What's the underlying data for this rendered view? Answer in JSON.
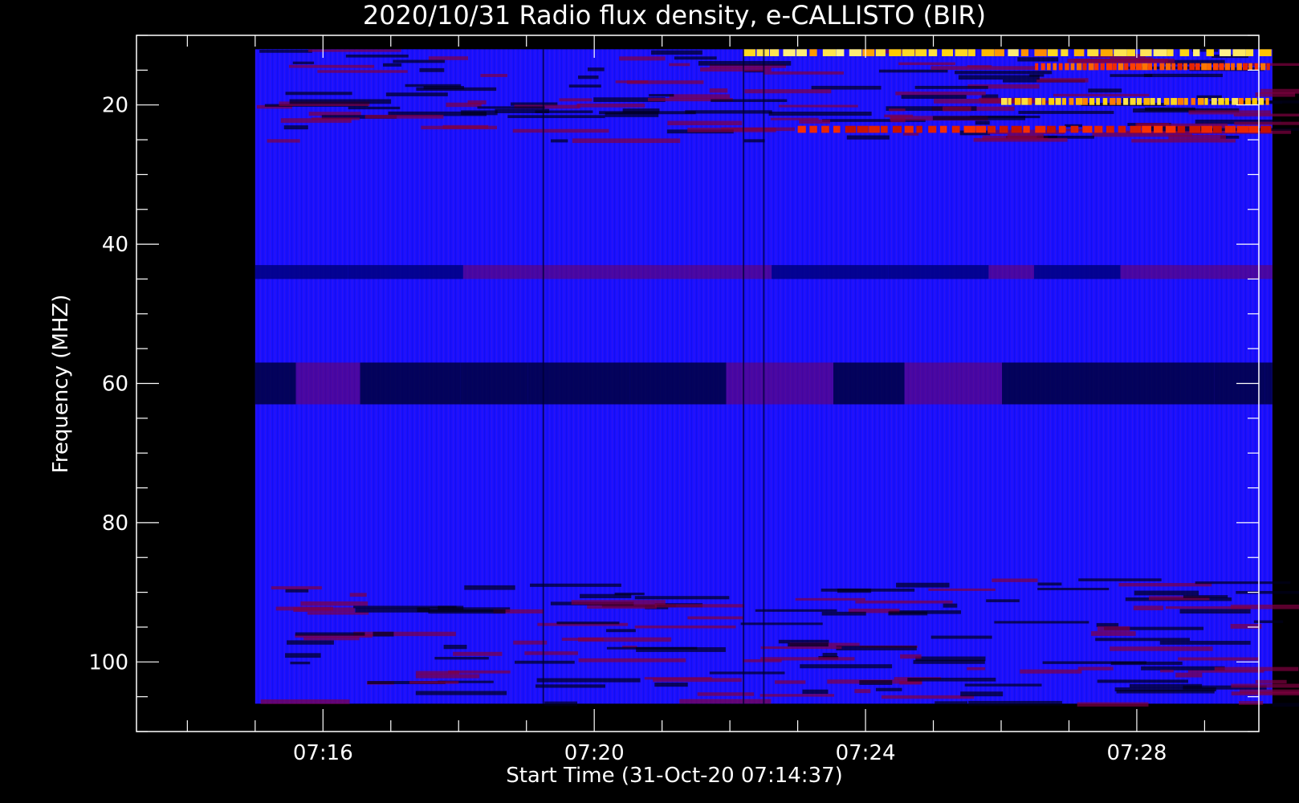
{
  "chart_data": {
    "type": "heatmap",
    "title": "2020/10/31  Radio flux density, e-CALLISTO (BIR)",
    "xlabel": "Start Time (31-Oct-20 07:14:37)",
    "ylabel": "Frequency (MHZ)",
    "x_axis": {
      "unit": "minutes past 07:00 UT",
      "range": [
        13.25,
        29.8
      ],
      "data_range": [
        15.0,
        30.0
      ],
      "major_ticks": [
        16,
        20,
        24,
        28
      ],
      "tick_labels": [
        "07:16",
        "07:20",
        "07:24",
        "07:28"
      ],
      "minor_tick_step": 1
    },
    "y_axis": {
      "unit": "MHz",
      "reversed": true,
      "range": [
        10,
        110
      ],
      "data_range": [
        12,
        106
      ],
      "major_ticks": [
        20,
        40,
        60,
        80,
        100
      ],
      "tick_labels": [
        "20",
        "40",
        "60",
        "80",
        "100"
      ],
      "minor_tick_step": 5
    },
    "colormap": [
      "#000000",
      "#0000ff",
      "#aa0000",
      "#ff3300",
      "#ffd000",
      "#ffffc0"
    ],
    "background_color": "#1a10ff",
    "features": [
      {
        "kind": "dark_band",
        "f_low": 57,
        "f_high": 63,
        "level": 0.05
      },
      {
        "kind": "dark_band",
        "f_low": 43,
        "f_high": 45,
        "level": 0.1
      },
      {
        "kind": "interference",
        "f_low": 12,
        "f_high": 25,
        "level": 0.35
      },
      {
        "kind": "interference",
        "f_low": 88,
        "f_high": 106,
        "level": 0.35
      },
      {
        "kind": "burst",
        "t_start": 22.2,
        "t_end": 30.0,
        "f_low": 12,
        "f_high": 13,
        "level": 0.95
      },
      {
        "kind": "burst",
        "t_start": 26.0,
        "t_end": 30.0,
        "f_low": 19,
        "f_high": 20,
        "level": 0.9
      },
      {
        "kind": "burst",
        "t_start": 26.5,
        "t_end": 30.0,
        "f_low": 14,
        "f_high": 15,
        "level": 0.7
      },
      {
        "kind": "burst",
        "t_start": 23.0,
        "t_end": 30.0,
        "f_low": 23,
        "f_high": 24,
        "level": 0.6
      }
    ]
  }
}
